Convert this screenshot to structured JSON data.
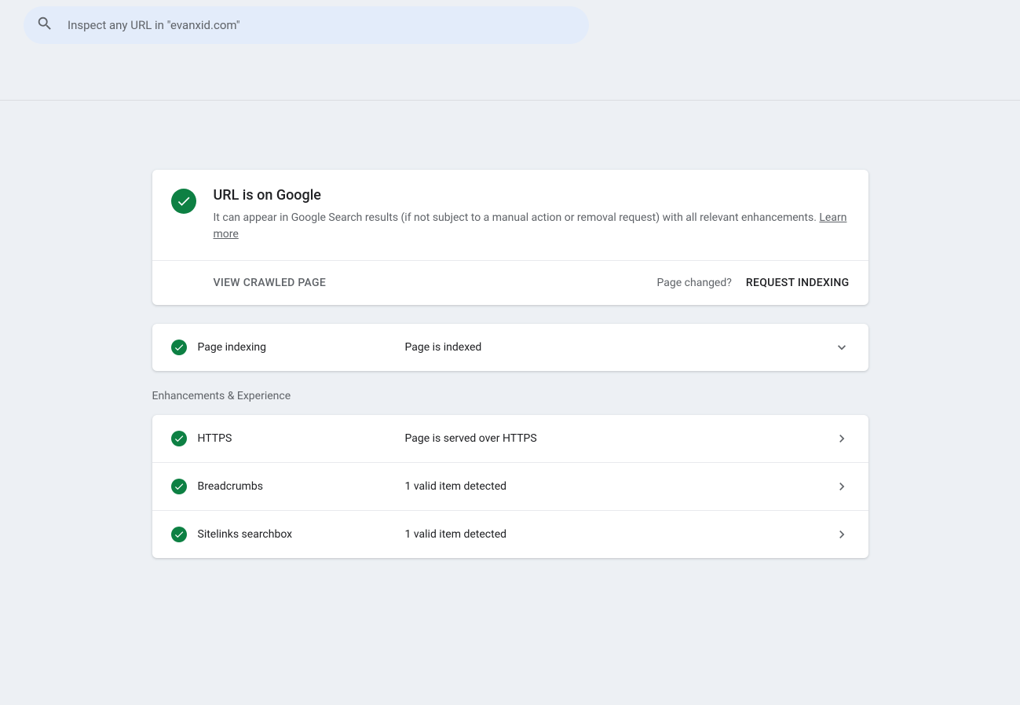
{
  "search": {
    "placeholder": "Inspect any URL in \"evanxid.com\""
  },
  "status": {
    "title": "URL is on Google",
    "description": "It can appear in Google Search results (if not subject to a manual action or removal request) with all relevant enhancements. ",
    "learn_more": "Learn more"
  },
  "actions": {
    "view_crawled": "VIEW CRAWLED PAGE",
    "page_changed": "Page changed?",
    "request_indexing": "REQUEST INDEXING"
  },
  "indexing": {
    "label": "Page indexing",
    "value": "Page is indexed"
  },
  "section_title": "Enhancements & Experience",
  "enhancements": [
    {
      "label": "HTTPS",
      "value": "Page is served over HTTPS"
    },
    {
      "label": "Breadcrumbs",
      "value": "1 valid item detected"
    },
    {
      "label": "Sitelinks searchbox",
      "value": "1 valid item detected"
    }
  ]
}
